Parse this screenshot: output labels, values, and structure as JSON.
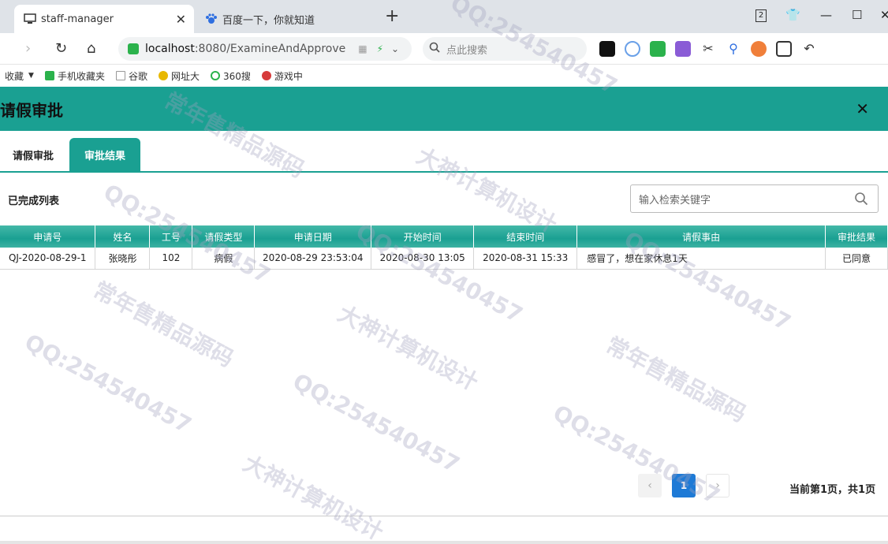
{
  "browser": {
    "tabs": [
      {
        "title": "staff-manager",
        "icon": "monitor-icon"
      },
      {
        "title": "百度一下，你就知道",
        "icon": "baidu-paw-icon"
      }
    ],
    "tab_counter": "2",
    "url_host": "localhost",
    "url_rest": ":8080/ExamineAndApprove",
    "search_placeholder": "点此搜索",
    "bookmarks": [
      "收藏",
      "手机收藏夹",
      "谷歌",
      "网址大",
      "360搜",
      "游戏中"
    ]
  },
  "modal": {
    "title": "请假审批",
    "tabs": [
      "请假审批",
      "审批结果"
    ],
    "active_tab": 1,
    "list_title": "已完成列表",
    "search_placeholder": "输入检索关键字"
  },
  "table": {
    "columns": [
      "申请号",
      "姓名",
      "工号",
      "请假类型",
      "申请日期",
      "开始时间",
      "结束时间",
      "请假事由",
      "审批结果"
    ],
    "rows": [
      [
        "QJ-2020-08-29-1",
        "张晓彤",
        "102",
        "病假",
        "2020-08-29 23:53:04",
        "2020-08-30 13:05",
        "2020-08-31 15:33",
        "感冒了，想在家休息1天",
        "已同意"
      ]
    ]
  },
  "pagination": {
    "prev": "‹",
    "current": "1",
    "next": "›",
    "info": "当前第1页，共1页"
  },
  "watermarks": [
    "QQ:254540457",
    "大神计算机设计",
    "常年售精品源码"
  ],
  "colors": {
    "accent": "#1aa092",
    "page_active": "#1e7ad6"
  }
}
